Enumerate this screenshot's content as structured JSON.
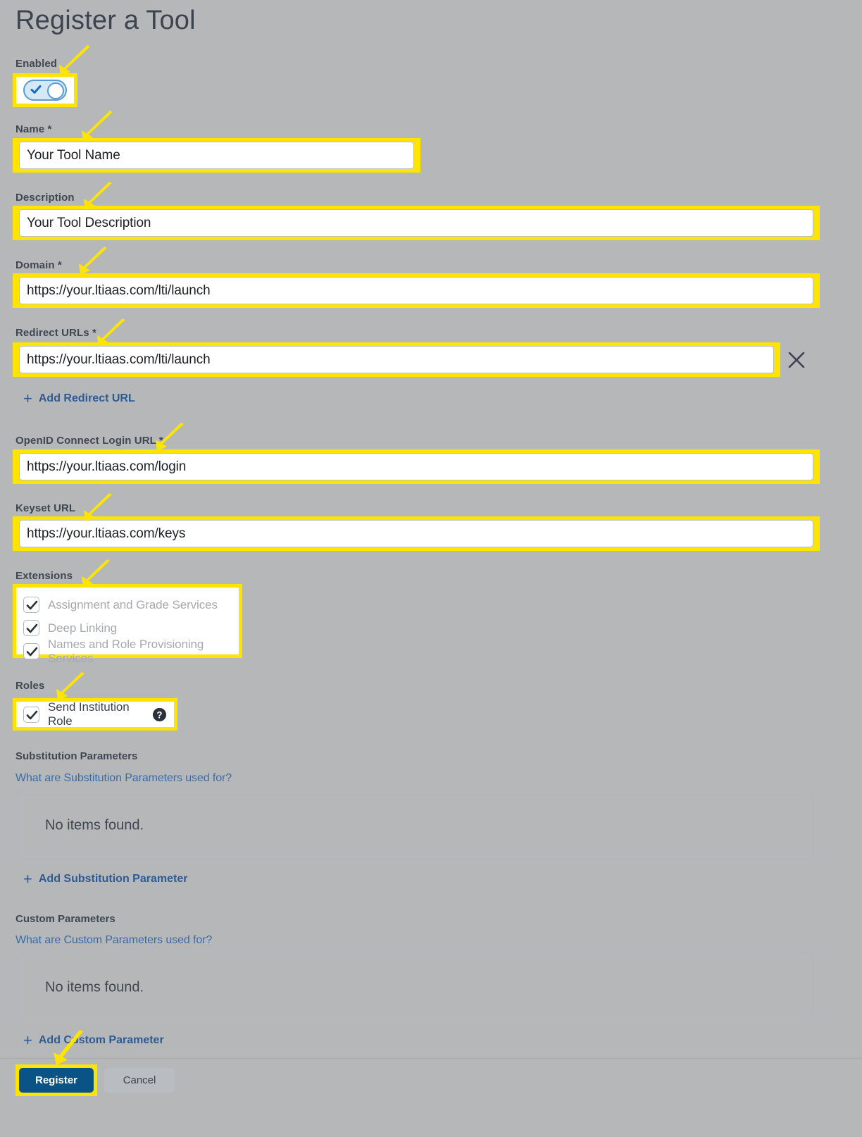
{
  "page": {
    "title": "Register a Tool"
  },
  "colors": {
    "background": "#b6b7b9",
    "highlight": "#ffe400",
    "primary_button": "#0a5387",
    "link": "#2d5b93",
    "toggle_on": "#d4e8f7"
  },
  "fields": {
    "enabled": {
      "label": "Enabled",
      "state": "on"
    },
    "name": {
      "label": "Name",
      "required_marker": "*",
      "value": "Your Tool Name"
    },
    "description": {
      "label": "Description",
      "required_marker": "",
      "value": "Your Tool Description"
    },
    "domain": {
      "label": "Domain",
      "required_marker": "*",
      "value": "https://your.ltiaas.com/lti/launch"
    },
    "redirect_urls": {
      "label": "Redirect URLs",
      "required_marker": "*",
      "value": "https://your.ltiaas.com/lti/launch",
      "remove_icon": "close-icon",
      "add_label": "Add Redirect URL",
      "add_icon": "plus-icon"
    },
    "openid_login_url": {
      "label": "OpenID Connect Login URL",
      "required_marker": "*",
      "value": "https://your.ltiaas.com/login"
    },
    "keyset_url": {
      "label": "Keyset URL",
      "required_marker": "",
      "value": "https://your.ltiaas.com/keys"
    }
  },
  "extensions": {
    "label": "Extensions",
    "items": [
      {
        "label": "Assignment and Grade Services",
        "checked": true,
        "disabled": true
      },
      {
        "label": "Deep Linking",
        "checked": true,
        "disabled": true
      },
      {
        "label": "Names and Role Provisioning Services",
        "checked": true,
        "disabled": true
      }
    ]
  },
  "roles": {
    "label": "Roles",
    "items": [
      {
        "label": "Send Institution Role",
        "checked": true,
        "disabled": false,
        "help_icon": "help-circle-icon"
      }
    ]
  },
  "substitution_parameters": {
    "label": "Substitution Parameters",
    "help_link": "What are Substitution Parameters used for?",
    "empty_text": "No items found.",
    "add_label": "Add Substitution Parameter",
    "add_icon": "plus-icon"
  },
  "custom_parameters": {
    "label": "Custom Parameters",
    "help_link": "What are Custom Parameters used for?",
    "empty_text": "No items found.",
    "add_label": "Add Custom Parameter",
    "add_icon": "plus-icon"
  },
  "footer": {
    "register_label": "Register",
    "cancel_label": "Cancel"
  }
}
